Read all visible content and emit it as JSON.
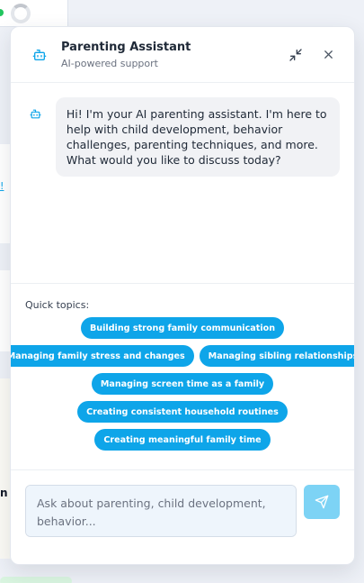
{
  "header": {
    "title": "Parenting Assistant",
    "subtitle": "AI-powered support",
    "icons": {
      "bot": "bot-icon",
      "minimize": "minimize-icon",
      "close": "close-icon"
    }
  },
  "messages": [
    {
      "sender": "assistant",
      "text": "Hi! I'm your AI parenting assistant. I'm here to help with child development, behavior challenges, parenting techniques, and more. What would you like to discuss today?"
    }
  ],
  "quick_topics": {
    "label": "Quick topics:",
    "items": [
      "Building strong family communication",
      "Managing family stress and changes",
      "Managing sibling relationships",
      "Managing screen time as a family",
      "Creating consistent household routines",
      "Creating meaningful family time"
    ]
  },
  "composer": {
    "placeholder": "Ask about parenting, child development, behavior...",
    "send_icon": "send-icon"
  },
  "colors": {
    "accent": "#0ea5e9",
    "send_disabled": "#7dd3f5",
    "bubble": "#f1f2f5",
    "input_bg": "#eef5fc"
  }
}
